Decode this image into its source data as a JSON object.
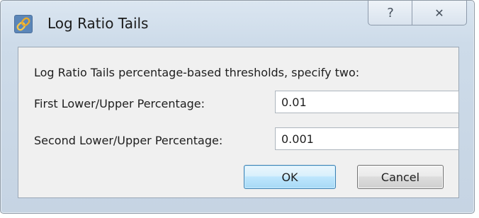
{
  "window": {
    "title": "Log Ratio Tails",
    "help_glyph": "?",
    "close_glyph": "✕"
  },
  "dialog": {
    "description": "Log Ratio Tails percentage-based thresholds, specify two:",
    "fields": [
      {
        "label": "First Lower/Upper Percentage:",
        "value": "0.01"
      },
      {
        "label": "Second Lower/Upper Percentage:",
        "value": "0.001"
      }
    ],
    "ok_label": "OK",
    "cancel_label": "Cancel"
  },
  "icons": {
    "app": "chain-link-icon",
    "help": "help-icon",
    "close": "close-icon"
  },
  "colors": {
    "titlebar_bg": "#cddbe9",
    "client_bg": "#f0f0f0",
    "ok_border": "#3c7fb1"
  }
}
